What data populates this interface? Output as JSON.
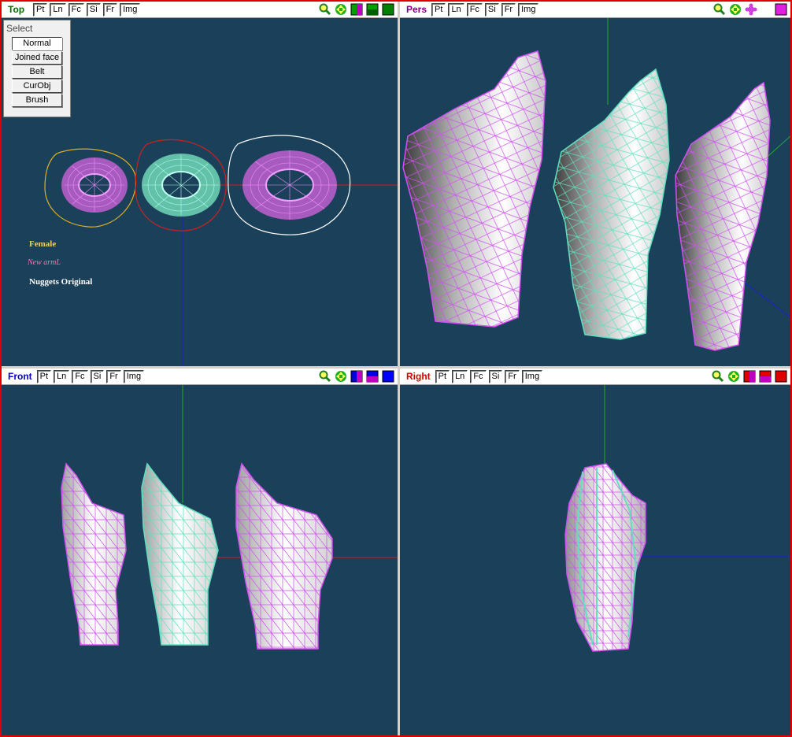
{
  "colors": {
    "viewport_bg": "#1b4059",
    "frame": "#e00000",
    "title_top": "#007000",
    "title_pers": "#800080",
    "title_front": "#0000c0",
    "title_right": "#d00000",
    "mesh_pink": "#d050f0",
    "mesh_cyan": "#60e0c0",
    "axis_red": "#d02020",
    "axis_green": "#20b020",
    "axis_blue": "#2020d0"
  },
  "panes": {
    "top": {
      "title": "Top",
      "buttons": [
        "Pt",
        "Ln",
        "Fc",
        "Si",
        "Fr",
        "Img"
      ],
      "icons": [
        "zoom-icon",
        "move-icon",
        "color-swatch-icon",
        "color-swatch-icon",
        "color-swatch-icon"
      ]
    },
    "pers": {
      "title": "Pers",
      "buttons": [
        "Pt",
        "Ln",
        "Fc",
        "Si",
        "Fr",
        "Img"
      ],
      "icons": [
        "zoom-icon",
        "move-icon",
        "rotate-icon",
        "color-swatch-icon"
      ]
    },
    "front": {
      "title": "Front",
      "buttons": [
        "Pt",
        "Ln",
        "Fc",
        "Si",
        "Fr",
        "Img"
      ],
      "icons": [
        "zoom-icon",
        "move-icon",
        "color-swatch-icon",
        "color-swatch-icon",
        "color-swatch-icon"
      ]
    },
    "right": {
      "title": "Right",
      "buttons": [
        "Pt",
        "Ln",
        "Fc",
        "Si",
        "Fr",
        "Img"
      ],
      "icons": [
        "zoom-icon",
        "move-icon",
        "color-swatch-icon",
        "color-swatch-icon",
        "color-swatch-icon"
      ]
    }
  },
  "select_panel": {
    "title": "Select",
    "buttons": [
      "Normal",
      "Joined face",
      "Belt",
      "CurObj",
      "Brush"
    ],
    "active": "Normal"
  },
  "legend": {
    "female": "Female",
    "new_arml": "New armL",
    "nuggets": "Nuggets Original",
    "female_color": "#f0d060",
    "new_color": "#ff70b0",
    "nuggets_color": "#ffffff"
  }
}
